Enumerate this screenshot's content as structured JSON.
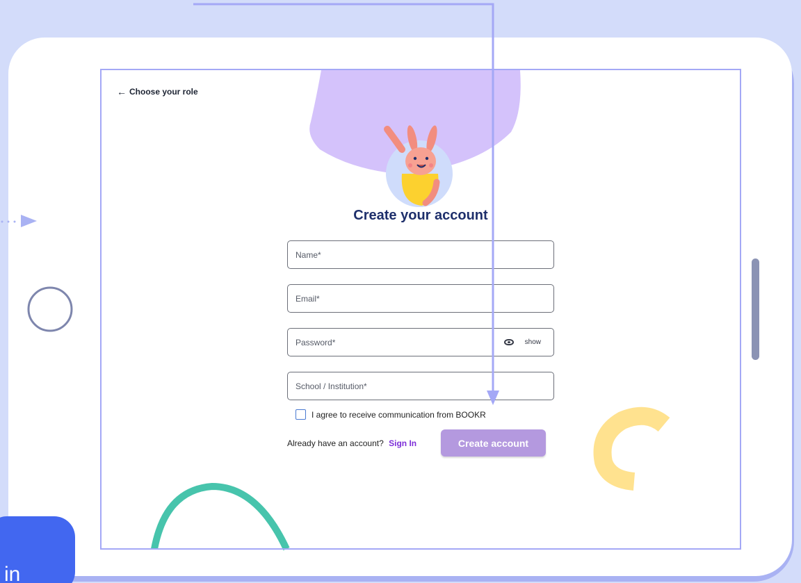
{
  "back_link": {
    "arrow": "←",
    "label": "Choose your role"
  },
  "title": "Create your account",
  "fields": {
    "name": {
      "placeholder": "Name*"
    },
    "email": {
      "placeholder": "Email*"
    },
    "password": {
      "placeholder": "Password*",
      "toggle_label": "show",
      "toggle_icon": "eye-icon"
    },
    "school": {
      "placeholder": "School / Institution*"
    }
  },
  "consent": {
    "label": "I agree to receive communication from BOOKR",
    "checked": false
  },
  "signin": {
    "prompt": "Already have an account?",
    "link": "Sign In"
  },
  "submit": {
    "label": "Create account"
  },
  "side_card": {
    "text": "in"
  },
  "colors": {
    "background": "#d3dcfa",
    "accent_purple": "#b499df",
    "link_purple": "#7d2fd8",
    "title_navy": "#1e2f6b",
    "frame_border": "#a4a8f6",
    "blob_lilac": "#d4c2fb",
    "arc_teal": "#47c4ac",
    "arc_yellow": "#ffe28f"
  }
}
